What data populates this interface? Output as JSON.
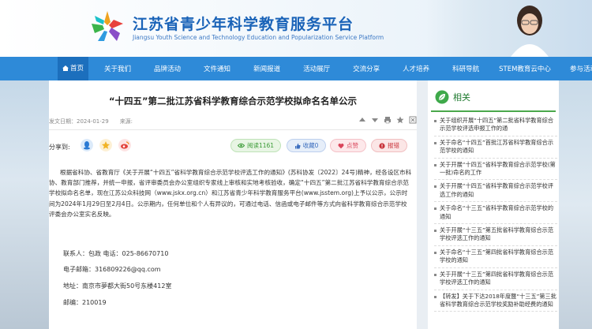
{
  "header": {
    "title": "江苏省青少年科学教育服务平台",
    "subtitle": "Jiangsu Youth Science and Technology Education and Popularization Service Platform"
  },
  "nav": {
    "items": [
      "首页",
      "关于我们",
      "品牌活动",
      "文件通知",
      "新闻报道",
      "活动展厅",
      "交流分享",
      "人才培养",
      "科研导航",
      "STEM教育云中心",
      "参与活动"
    ]
  },
  "article": {
    "title": "“十四五”第二批江苏省科学教育综合示范学校拟命名名单公示",
    "date_label": "发文日期：",
    "date": "2024-01-29",
    "source_label": "来源:",
    "share_label": "分享到:",
    "views": "阅读1161",
    "favorite": "收藏0",
    "like": "点赞",
    "report": "报错",
    "body": "根据省科协、省教育厅《关于开展“十四五”省科学教育综合示范学校评选工作的通知》(苏科协发〔2022〕24号)精神，经各设区市科协、教育部门推荐，并统一申报，省评审委员会办公室组织专家线上审核和实地考核验收，确定“十四五”第二批江苏省科学教育综合示范学校拟命名名单，现在江苏公众科技网（www.jskx.org.cn）和江苏省青少年科学教育服务平台(www.jsstem.org)上予以公示，公示时间为2024年1月29日至2月4日。公示期内，任何单位和个人有异议的，可通过电话、信函或电子邮件等方式向省科学教育综合示范学校评委会办公室实名反映。",
    "contact_person": "联系人：包政    电话：025-86670710",
    "email": "电子邮箱：316809226@qq.com",
    "address": "地址：南京市夢都大街50号东楼412室",
    "postcode": "邮编：210019"
  },
  "sidebar": {
    "title": "相关",
    "items": [
      "关于组织开展“十四五”第二批省科学教育综合示范学校评选申报工作的通",
      "关于命名“十四五”首批江苏省科学教育综合示范学校的通知",
      "关于开展“十四五”省科学教育综合示范学校(第一批)命名的工作",
      "关于开展“十四五”省科学教育综合示范学校评选工作的通知",
      "关于命名“十三五”省科学教育综合示范学校的通知",
      "关于开展“十三五”第五批省科学教育综合示范学校评选工作的通知",
      "关于命名“十三五”第四批省科学教育综合示范学校的通知",
      "关于开展“十三五”第四批省科学教育综合示范学校评选工作的通知",
      "【转发】关于下达2018年度暨“十三五”第三批省科学教育综合示范学校奖励补助经费的通知"
    ]
  },
  "colors": {
    "nav_bg": "#2e8ad8",
    "title_blue": "#1a63b8",
    "sidebar_green": "#4aa84b"
  }
}
